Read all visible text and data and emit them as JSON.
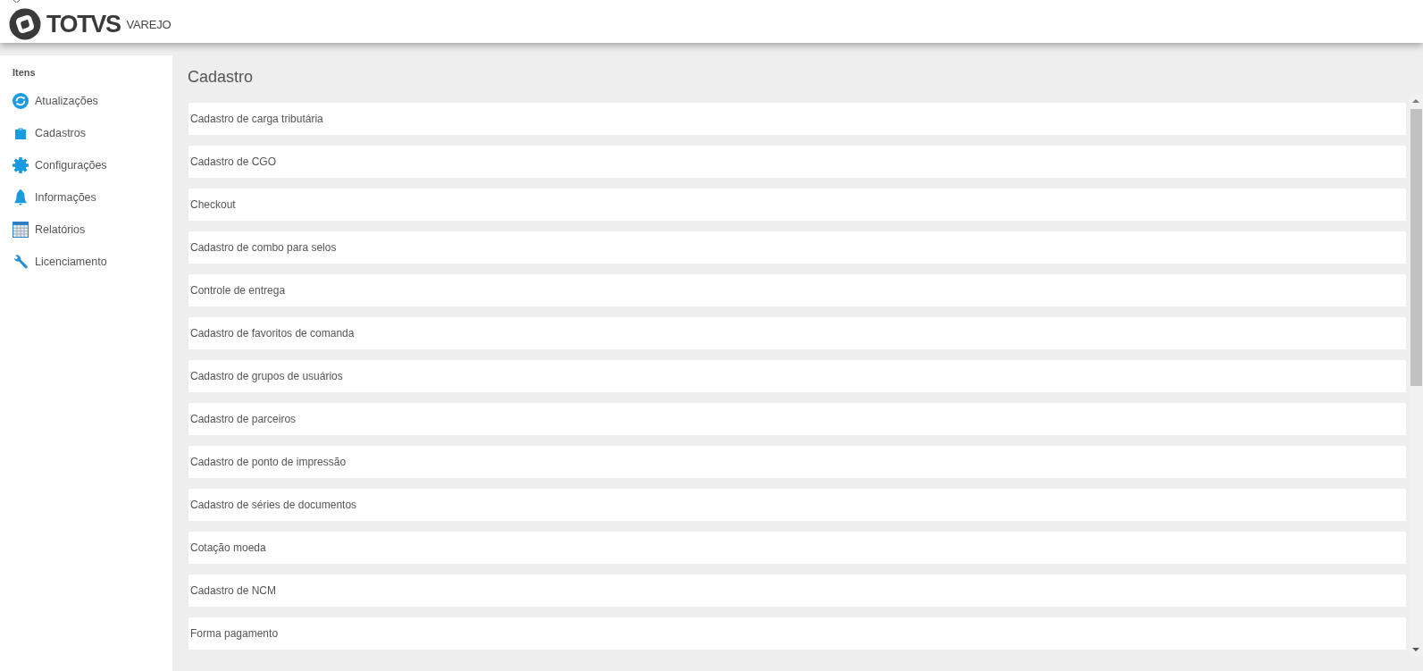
{
  "header": {
    "brand": "TOTVS",
    "product": "VAREJO"
  },
  "sidebar": {
    "heading": "Itens",
    "items": [
      "Atualizações",
      "Cadastros",
      "Configurações",
      "Informações",
      "Relatórios",
      "Licenciamento"
    ]
  },
  "main": {
    "title": "Cadastro",
    "items": [
      "Cadastro de carga tributária",
      "Cadastro de CGO",
      "Checkout",
      "Cadastro de combo para selos",
      "Controle de entrega",
      "Cadastro de favoritos de comanda",
      "Cadastro de grupos de usuários",
      "Cadastro de parceiros",
      "Cadastro de ponto de impressão",
      "Cadastro de séries de documentos",
      "Cotação moeda",
      "Cadastro de NCM",
      "Forma pagamento"
    ]
  }
}
